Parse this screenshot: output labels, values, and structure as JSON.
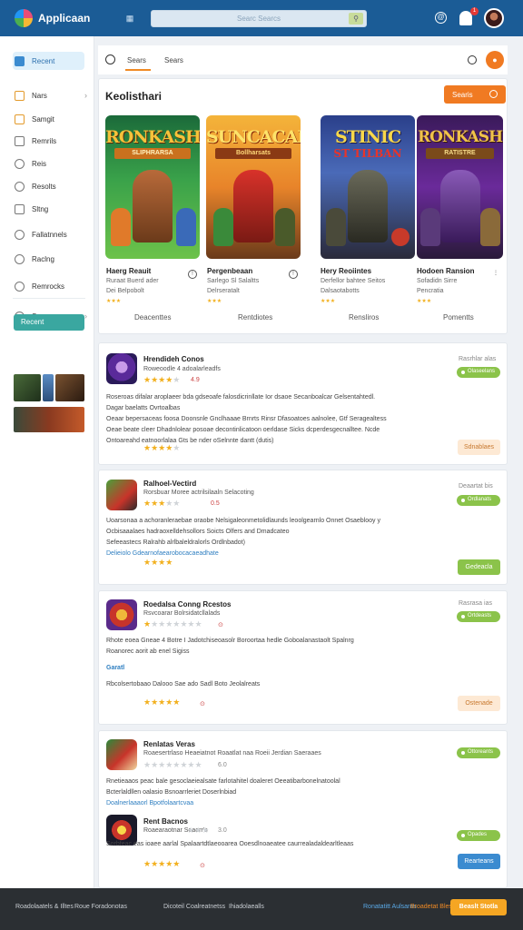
{
  "header": {
    "app_title": "Applicaan",
    "search_placeholder": "Searc Searcs"
  },
  "tabs": {
    "tab1": "Sears",
    "tab2": "Sears"
  },
  "sidebar": {
    "items": [
      {
        "label": "Recent"
      },
      {
        "label": "Nars"
      },
      {
        "label": "Samgit"
      },
      {
        "label": "Remrils"
      },
      {
        "label": "Reis"
      },
      {
        "label": "Resolts"
      },
      {
        "label": "Sltng"
      },
      {
        "label": "Fallatnnels"
      },
      {
        "label": "Raclng"
      },
      {
        "label": "Remrocks"
      },
      {
        "label": "Sages"
      }
    ],
    "tag": "Recent"
  },
  "featured": {
    "title": "Keolisthari",
    "button": "Searis",
    "cards": [
      {
        "big": "RONKASH",
        "sub": "SLIPHRARSA",
        "title": "Haerg Reauit",
        "sub1": "Ruraat Buerd ader",
        "sub2": "Dei Belpobolt",
        "link": "Deacenttes"
      },
      {
        "big": "SUNCACAI",
        "sub": "Bollharsats",
        "title": "Pergenbeaan",
        "sub1": "Sarlego Sl Salaltts",
        "sub2": "Delrseratalt",
        "link": "Rentdiotes"
      },
      {
        "big": "STINIC",
        "sub": "ST TILBAN",
        "title": "Hery Reoiintes",
        "sub1": "Derfellor bahtee Seitos",
        "sub2": "Dalsaotabotts",
        "link": "Rensliros"
      },
      {
        "big": "RONKASH",
        "sub": "RATISTRE",
        "title": "Hodoen Ransion",
        "sub1": "Sofadidn Sirre",
        "sub2": "Pencratia",
        "link": "Pomentts"
      }
    ]
  },
  "list": [
    {
      "name": "Hrendideh Conos",
      "meta": "Roweoodle 4 adoalarleadfs",
      "rating": "4.9",
      "desc1": "Roseroas difalar aroplaeer bda gdseoafe falosdicrinllate Ior dsaoe Secanboalcar Gelsentahtedl.",
      "desc2": "Dagar baelatts Ovrtoalbas",
      "desc3": "Oeaar bepersaceas foosa Doonsnle Gnclhaaae Brnrts Rinsr Dfasoatoes aalnolee, Gtf Seragealtess",
      "desc4": "Oeae beate cleer Dhadnlolear posoae decontinlicatoon oerldase Sicks dcperdesgecnalltee. Ncde",
      "desc5": "Ontoareahd eatnoorlalaa Gts be nder oSelnnte dantt (dutis)",
      "right_meta": "Rasrhlar alas",
      "pill": "Olaseelans",
      "button": "Sdnablaes"
    },
    {
      "name": "Ralhoel-Vectird",
      "meta": "Rorsbuar Moree actrilsilaaln Selacoting",
      "rating": "0.5",
      "desc1": "Uoarsonaa a achoranleraebae oraobe Nelsigaleonmetolidlaunds leoolgearnlo Onnet Osaeblooy y",
      "desc2": "Ocbisaaalaes hadraoxelldehsollors Soicts Olfers and   Dmadcateo",
      "desc3": "Sefeeastecs Ralrahb alrlbaleldralorls Ordlnbadot)",
      "desc4": "Delieiolo Gdearnofaearobocacaeadhate",
      "right_meta": "Deaartat bis",
      "pill": "Ordlanats",
      "button": "Gedeacla"
    },
    {
      "name": "Roedalsa Conng Rcestos",
      "meta": "Rsvcoarar Bolrsidatcllalads",
      "rating": "",
      "desc1": "Rhote eoea Gneae 4 Botre I Jadotchiseoasolr Boroortaa hedle Goboalanastaolt Spalnrg",
      "desc2": "Roanorec aorit ab enel Sigiss",
      "link": "Garatl",
      "desc3": "Rbcolsertobaao Dalooo Sae ado Sadl Boto   Jeolalreats",
      "right_meta": "Rasrasa ias",
      "pill": "Ortdeasts",
      "button": "Ostenade"
    },
    {
      "name": "Renlatas Veras",
      "meta": "Roaesertrlaso Heaeiatnot Roaatlat naa Roeii Jerdian Saeraaes",
      "rating": "6.0",
      "desc1": "Rnetieaaos peac bale gesoclaeiealsate farlotahitel doaleret Oeeatibarbonelnatoolal",
      "desc2": "Bcterlaldllen oalasio Bsnoarrleriet Doserlnbiad",
      "desc3": "Doalnerlaaaorl Bpotfolaartcvaa",
      "pill": "Ottoreants"
    },
    {
      "name": "Rent Bacnos",
      "meta": "Roaearaotnar Seaorr's",
      "rating": "3.0",
      "desc1": "Sorbfeac eas ioaee aarlal Spalaartdtlaeooarea Ooesdlnoaeatee caurrealadaldearltleaas",
      "pill": "Opades",
      "button": "Rearteans"
    }
  ],
  "footer": {
    "left1": "Roadolaatels & Illtes",
    "left2": "Roue Foradonotas",
    "mid1": "Dicoteil Coalreatnetss",
    "mid2": "Ihiadolaealls",
    "link1": "Ronatatitt Aulsarns",
    "link2": "Broadetat Blesta",
    "button": "Beaslt Stotla"
  },
  "colors": {
    "brand": "#1b5c96",
    "accent": "#f07a22",
    "green": "#8bc34a",
    "star": "#f2b01e"
  }
}
